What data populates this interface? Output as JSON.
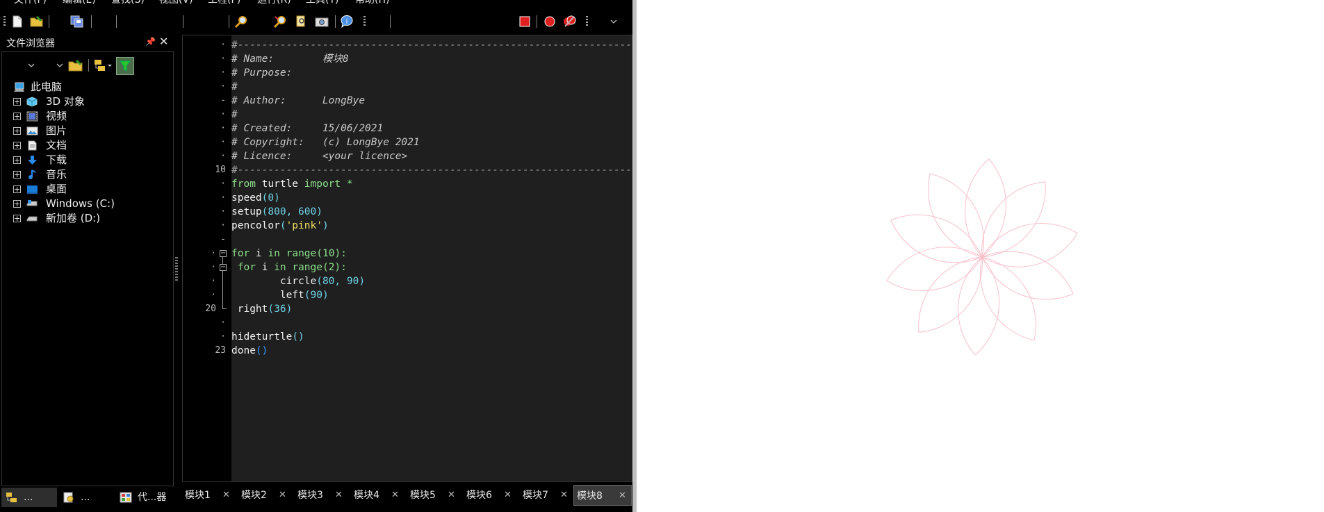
{
  "menu": [
    "文件(F)",
    "编辑(E)",
    "查找(S)",
    "视图(V)",
    "工程(P)",
    "运行(R)",
    "工具(T)",
    "帮助(H)"
  ],
  "file_browser": {
    "title": "文件浏览器",
    "root": "此电脑",
    "items": [
      {
        "label": "3D 对象",
        "icon": "3d-objects-icon"
      },
      {
        "label": "视频",
        "icon": "video-icon"
      },
      {
        "label": "图片",
        "icon": "pictures-icon"
      },
      {
        "label": "文档",
        "icon": "documents-icon"
      },
      {
        "label": "下载",
        "icon": "downloads-icon"
      },
      {
        "label": "音乐",
        "icon": "music-icon"
      },
      {
        "label": "桌面",
        "icon": "desktop-icon"
      },
      {
        "label": "Windows (C:)",
        "icon": "drive-c-icon"
      },
      {
        "label": "新加卷 (D:)",
        "icon": "drive-d-icon"
      }
    ]
  },
  "bottom_tabs": [
    "...",
    "...",
    "代...器"
  ],
  "editor": {
    "line_numbers": {
      "l10": "10",
      "l20": "20",
      "l23": "23"
    },
    "code": {
      "c1": "#----------------------------------------------------------------------------------------",
      "c2": "# Name:        模块8",
      "c3": "# Purpose:",
      "c4": "#",
      "c5": "# Author:      LongBye",
      "c6": "#",
      "c7": "# Created:     15/06/2021",
      "c8": "# Copyright:   (c) LongBye 2021",
      "c9": "# Licence:     <your licence>",
      "c10": "#----------------------------------------------------------------------------------------",
      "c11_kw1": "from",
      "c11_mid": " turtle ",
      "c11_kw2": "import",
      "c11_end": " *",
      "c12_fn": "speed",
      "c12_args": "(0)",
      "c13_fn": "setup",
      "c13_args": "(800, 600)",
      "c14_fn": "pencolor",
      "c14_p1": "(",
      "c14_str": "'pink'",
      "c14_p2": ")",
      "c16_kw": "for",
      "c16_var": " i ",
      "c16_in": "in",
      "c16_rest": " range(10):",
      "c17_kw": " for",
      "c17_var": " i ",
      "c17_in": "in",
      "c17_rest": " range(2):",
      "c18_fn": "        circle",
      "c18_args": "(80, 90)",
      "c19_fn": "        left",
      "c19_args": "(90)",
      "c20_fn": " right",
      "c20_args": "(36)",
      "c22_fn": "hideturtle",
      "c22_args": "()",
      "c23_fn": "done",
      "c23_args": "()"
    }
  },
  "module_tabs": [
    "模块1",
    "模块2",
    "模块3",
    "模块4",
    "模块5",
    "模块6",
    "模块7",
    "模块8"
  ],
  "active_module": "模块8",
  "turtle": {
    "petals": 10,
    "pen_color": "#f7c0cb",
    "background": "#ffffff"
  }
}
